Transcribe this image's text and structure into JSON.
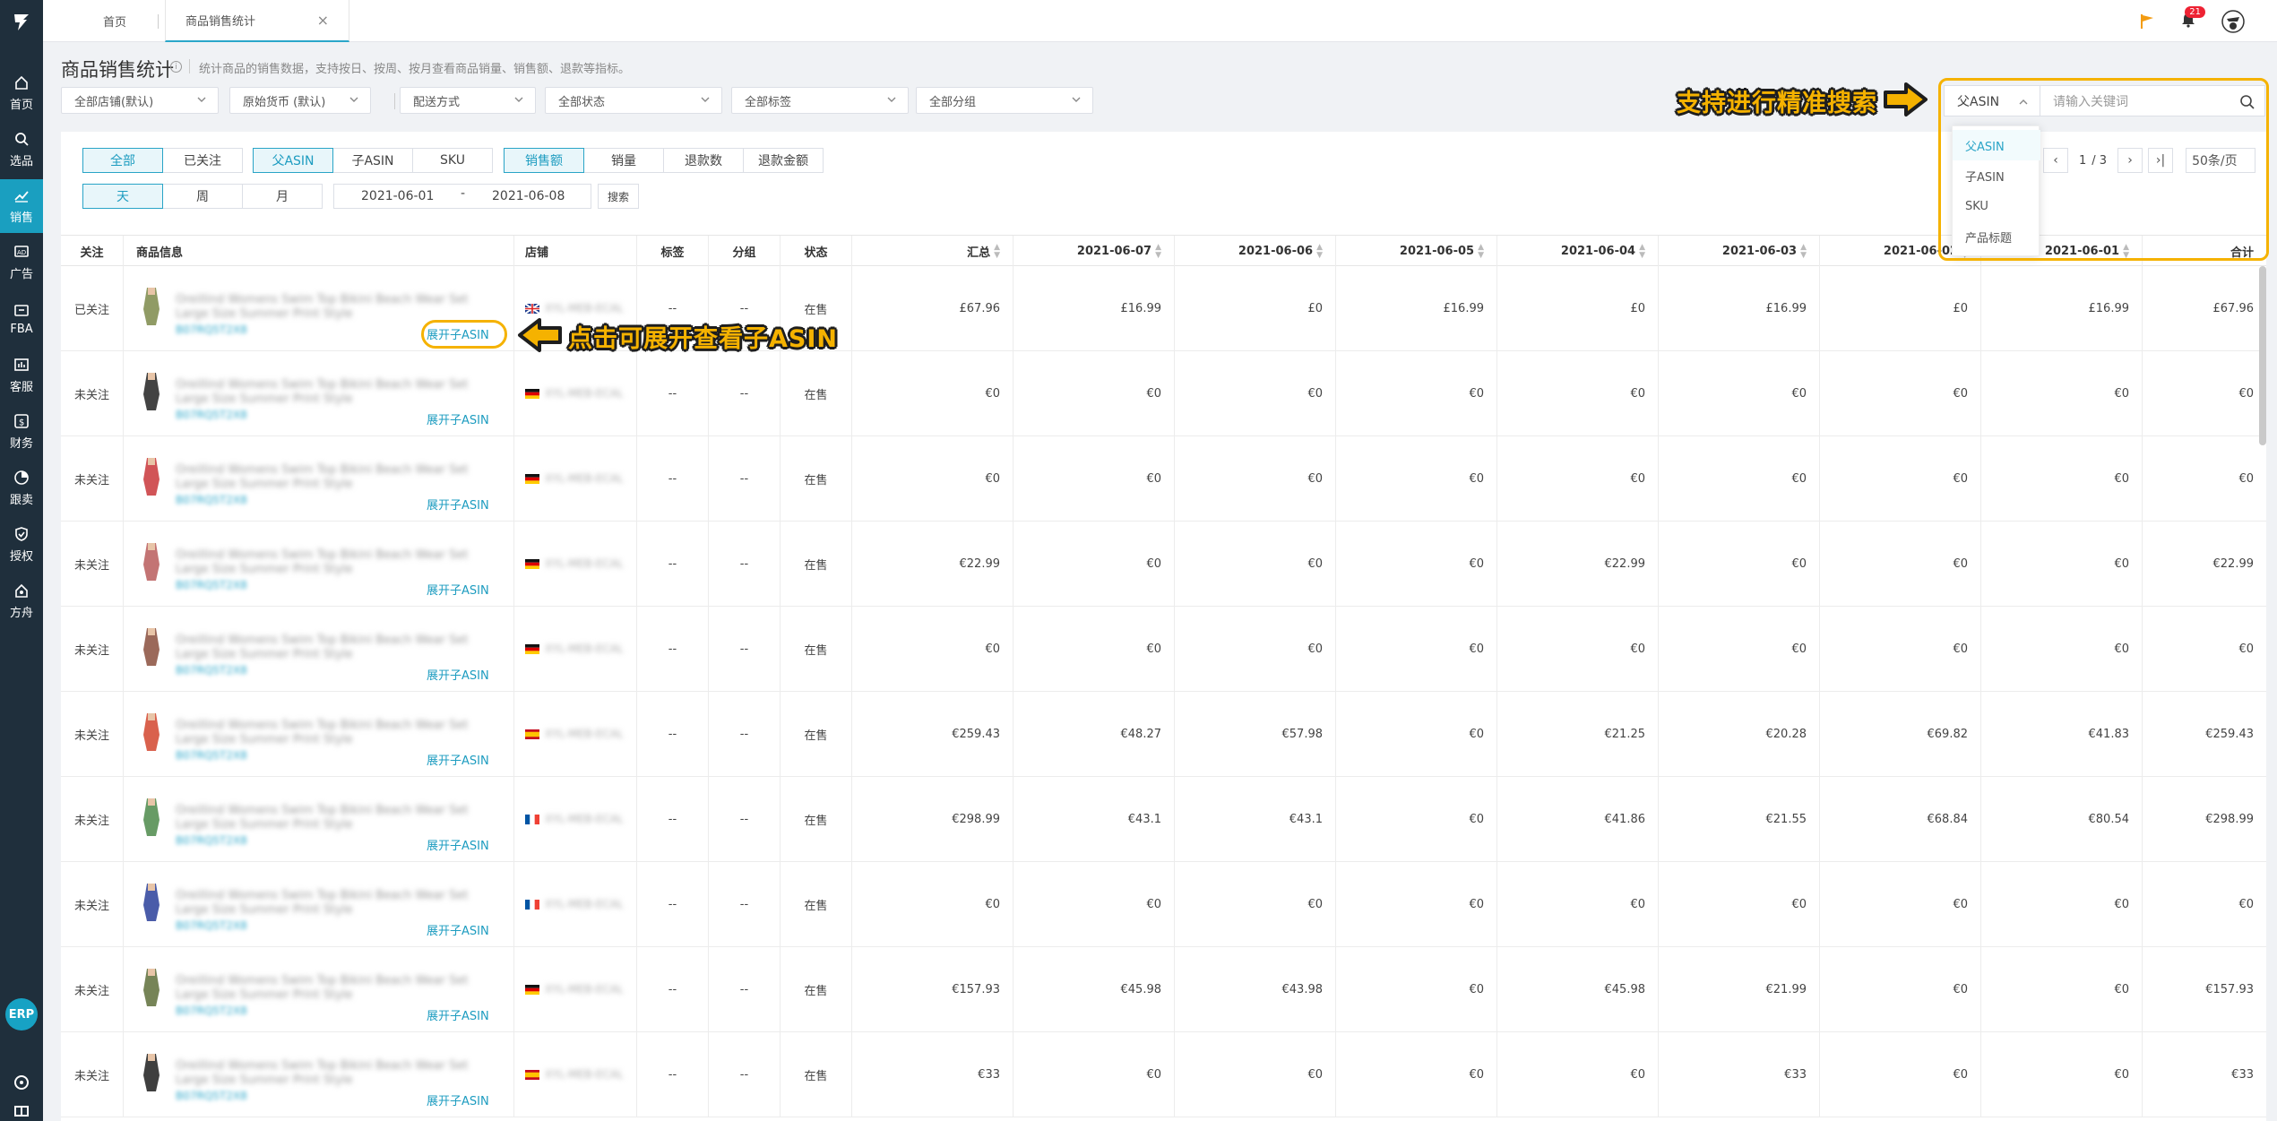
{
  "nav": {
    "items": [
      {
        "label": "首页",
        "icon": "home-icon"
      },
      {
        "label": "选品",
        "icon": "search-icon"
      },
      {
        "label": "销售",
        "icon": "chart-icon",
        "active": true
      },
      {
        "label": "广告",
        "icon": "ad-icon"
      },
      {
        "label": "FBA",
        "icon": "box-icon"
      },
      {
        "label": "客服",
        "icon": "service-icon"
      },
      {
        "label": "财务",
        "icon": "dollar-icon"
      },
      {
        "label": "跟卖",
        "icon": "pie-icon"
      },
      {
        "label": "授权",
        "icon": "shield-icon"
      },
      {
        "label": "方舟",
        "icon": "ark-icon"
      }
    ],
    "erp_label": "ERP"
  },
  "tabs": {
    "home": "首页",
    "current": "商品销售统计",
    "close": "×"
  },
  "notifications": {
    "count": "21"
  },
  "header": {
    "title": "商品销售统计",
    "info": "i",
    "description": "统计商品的销售数据，支持按日、按周、按月查看商品销量、销售额、退款等指标。"
  },
  "filters": {
    "store": "全部店铺(默认)",
    "currency": "原始货币 (默认)",
    "shipping": "配送方式",
    "status": "全部状态",
    "tag": "全部标签",
    "group": "全部分组"
  },
  "search": {
    "type": "父ASIN",
    "placeholder": "请输入关键词",
    "options": [
      "父ASIN",
      "子ASIN",
      "SKU",
      "产品标题"
    ]
  },
  "toggles": {
    "follow": [
      "全部",
      "已关注"
    ],
    "asin": [
      "父ASIN",
      "子ASIN",
      "SKU"
    ],
    "metric": [
      "销售额",
      "销量",
      "退款数",
      "退款金额"
    ],
    "period": [
      "天",
      "周",
      "月"
    ]
  },
  "daterange": {
    "start": "2021-06-01",
    "sep": "-",
    "end": "2021-06-08",
    "search_btn": "搜索"
  },
  "pager": {
    "prev": "‹",
    "page": "1",
    "total": "/ 3",
    "next": "›",
    "last": "›|",
    "size": "50条/页"
  },
  "table": {
    "headers": {
      "follow": "关注",
      "product": "商品信息",
      "store": "店铺",
      "tag": "标签",
      "group": "分组",
      "status": "状态",
      "summary": "汇总",
      "dates": [
        "2021-06-07",
        "2021-06-06",
        "2021-06-05",
        "2021-06-04",
        "2021-06-03",
        "2021-06-02",
        "2021-06-01"
      ],
      "total": "合计"
    },
    "expand_label": "展开子ASIN",
    "rows": [
      {
        "follow": "已关注",
        "tag": "--",
        "group": "--",
        "status": "在售",
        "flag": "uk",
        "summary": "£67.96",
        "d": [
          "£16.99",
          "£0",
          "£16.99",
          "£0",
          "£16.99",
          "£0",
          "£16.99"
        ],
        "total": "£67.96",
        "color": "#7d8a4a"
      },
      {
        "follow": "未关注",
        "tag": "--",
        "group": "--",
        "status": "在售",
        "flag": "de",
        "summary": "€0",
        "d": [
          "€0",
          "€0",
          "€0",
          "€0",
          "€0",
          "€0",
          "€0"
        ],
        "total": "€0",
        "color": "#222222"
      },
      {
        "follow": "未关注",
        "tag": "--",
        "group": "--",
        "status": "在售",
        "flag": "de",
        "summary": "€0",
        "d": [
          "€0",
          "€0",
          "€0",
          "€0",
          "€0",
          "€0",
          "€0"
        ],
        "total": "€0",
        "color": "#c9363a"
      },
      {
        "follow": "未关注",
        "tag": "--",
        "group": "--",
        "status": "在售",
        "flag": "de",
        "summary": "€22.99",
        "d": [
          "€0",
          "€0",
          "€0",
          "€22.99",
          "€0",
          "€0",
          "€0"
        ],
        "total": "€22.99",
        "color": "#b85c5c"
      },
      {
        "follow": "未关注",
        "tag": "--",
        "group": "--",
        "status": "在售",
        "flag": "de",
        "summary": "€0",
        "d": [
          "€0",
          "€0",
          "€0",
          "€0",
          "€0",
          "€0",
          "€0"
        ],
        "total": "€0",
        "color": "#8a4f3d"
      },
      {
        "follow": "未关注",
        "tag": "--",
        "group": "--",
        "status": "在售",
        "flag": "es",
        "summary": "€259.43",
        "d": [
          "€48.27",
          "€57.98",
          "€0",
          "€21.25",
          "€20.28",
          "€69.82",
          "€41.83"
        ],
        "total": "€259.43",
        "color": "#d2452e"
      },
      {
        "follow": "未关注",
        "tag": "--",
        "group": "--",
        "status": "在售",
        "flag": "fr",
        "summary": "€298.99",
        "d": [
          "€43.1",
          "€43.1",
          "€0",
          "€41.86",
          "€21.55",
          "€68.84",
          "€80.54"
        ],
        "total": "€298.99",
        "color": "#4c8a4a"
      },
      {
        "follow": "未关注",
        "tag": "--",
        "group": "--",
        "status": "在售",
        "flag": "fr",
        "summary": "€0",
        "d": [
          "€0",
          "€0",
          "€0",
          "€0",
          "€0",
          "€0",
          "€0"
        ],
        "total": "€0",
        "color": "#2a3f9a"
      },
      {
        "follow": "未关注",
        "tag": "--",
        "group": "--",
        "status": "在售",
        "flag": "de",
        "summary": "€157.93",
        "d": [
          "€45.98",
          "€43.98",
          "€0",
          "€45.98",
          "€21.99",
          "€0",
          "€0"
        ],
        "total": "€157.93",
        "color": "#5e6e3a"
      },
      {
        "follow": "未关注",
        "tag": "--",
        "group": "--",
        "status": "在售",
        "flag": "es",
        "summary": "€33",
        "d": [
          "€0",
          "€0",
          "€0",
          "€0",
          "€33",
          "€0",
          "€0"
        ],
        "total": "€33",
        "color": "#1d1d1d"
      }
    ]
  },
  "annotations": {
    "search_tip": "支持进行精准搜索",
    "expand_tip": "点击可展开查看子ASIN",
    "accent": "#f5b200"
  }
}
